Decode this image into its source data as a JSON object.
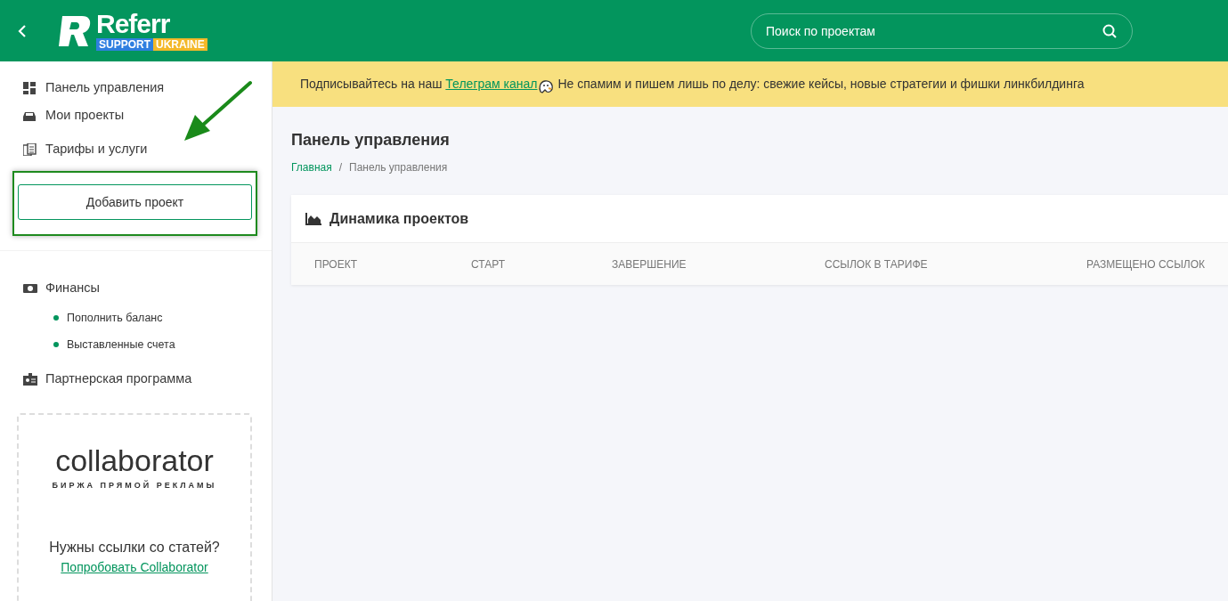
{
  "header": {
    "logo_text": "Referr",
    "logo_badge": [
      "SUPPORT",
      "UKRAINE"
    ],
    "search": {
      "placeholder": "Поиск по проектам"
    }
  },
  "sidebar": {
    "items": [
      {
        "label": "Панель управления"
      },
      {
        "label": "Мои проекты"
      },
      {
        "label": "Тарифы и услуги"
      }
    ],
    "add_button": "Добавить проект",
    "sections": [
      {
        "label": "Финансы",
        "children": [
          {
            "label": "Пополнить баланс"
          },
          {
            "label": "Выставленные счета"
          }
        ]
      },
      {
        "label": "Партнерская программа"
      }
    ],
    "promo": {
      "logo": "collaborator",
      "tagline": "БИРЖА ПРЯМОЙ РЕКЛАМЫ",
      "question": "Нужны ссылки со статей?",
      "link": "Попробовать Collaborator"
    }
  },
  "notice": {
    "before": "Подписывайтесь на наш",
    "link": "Телеграм канал",
    "after": "Не спамим и пишем лишь по делу: свежие кейсы, новые стратегии и фишки линкбилдинга"
  },
  "page": {
    "title": "Панель управления",
    "breadcrumbs": [
      "Главная",
      "Панель управления"
    ],
    "breadcrumb_separator": "/"
  },
  "card": {
    "title": "Динамика проектов",
    "columns": [
      "ПРОЕКТ",
      "СТАРТ",
      "ЗАВЕРШЕНИЕ",
      "ССЫЛОК В ТАРИФЕ",
      "РАЗМЕЩЕНО ССЫЛОК"
    ]
  }
}
